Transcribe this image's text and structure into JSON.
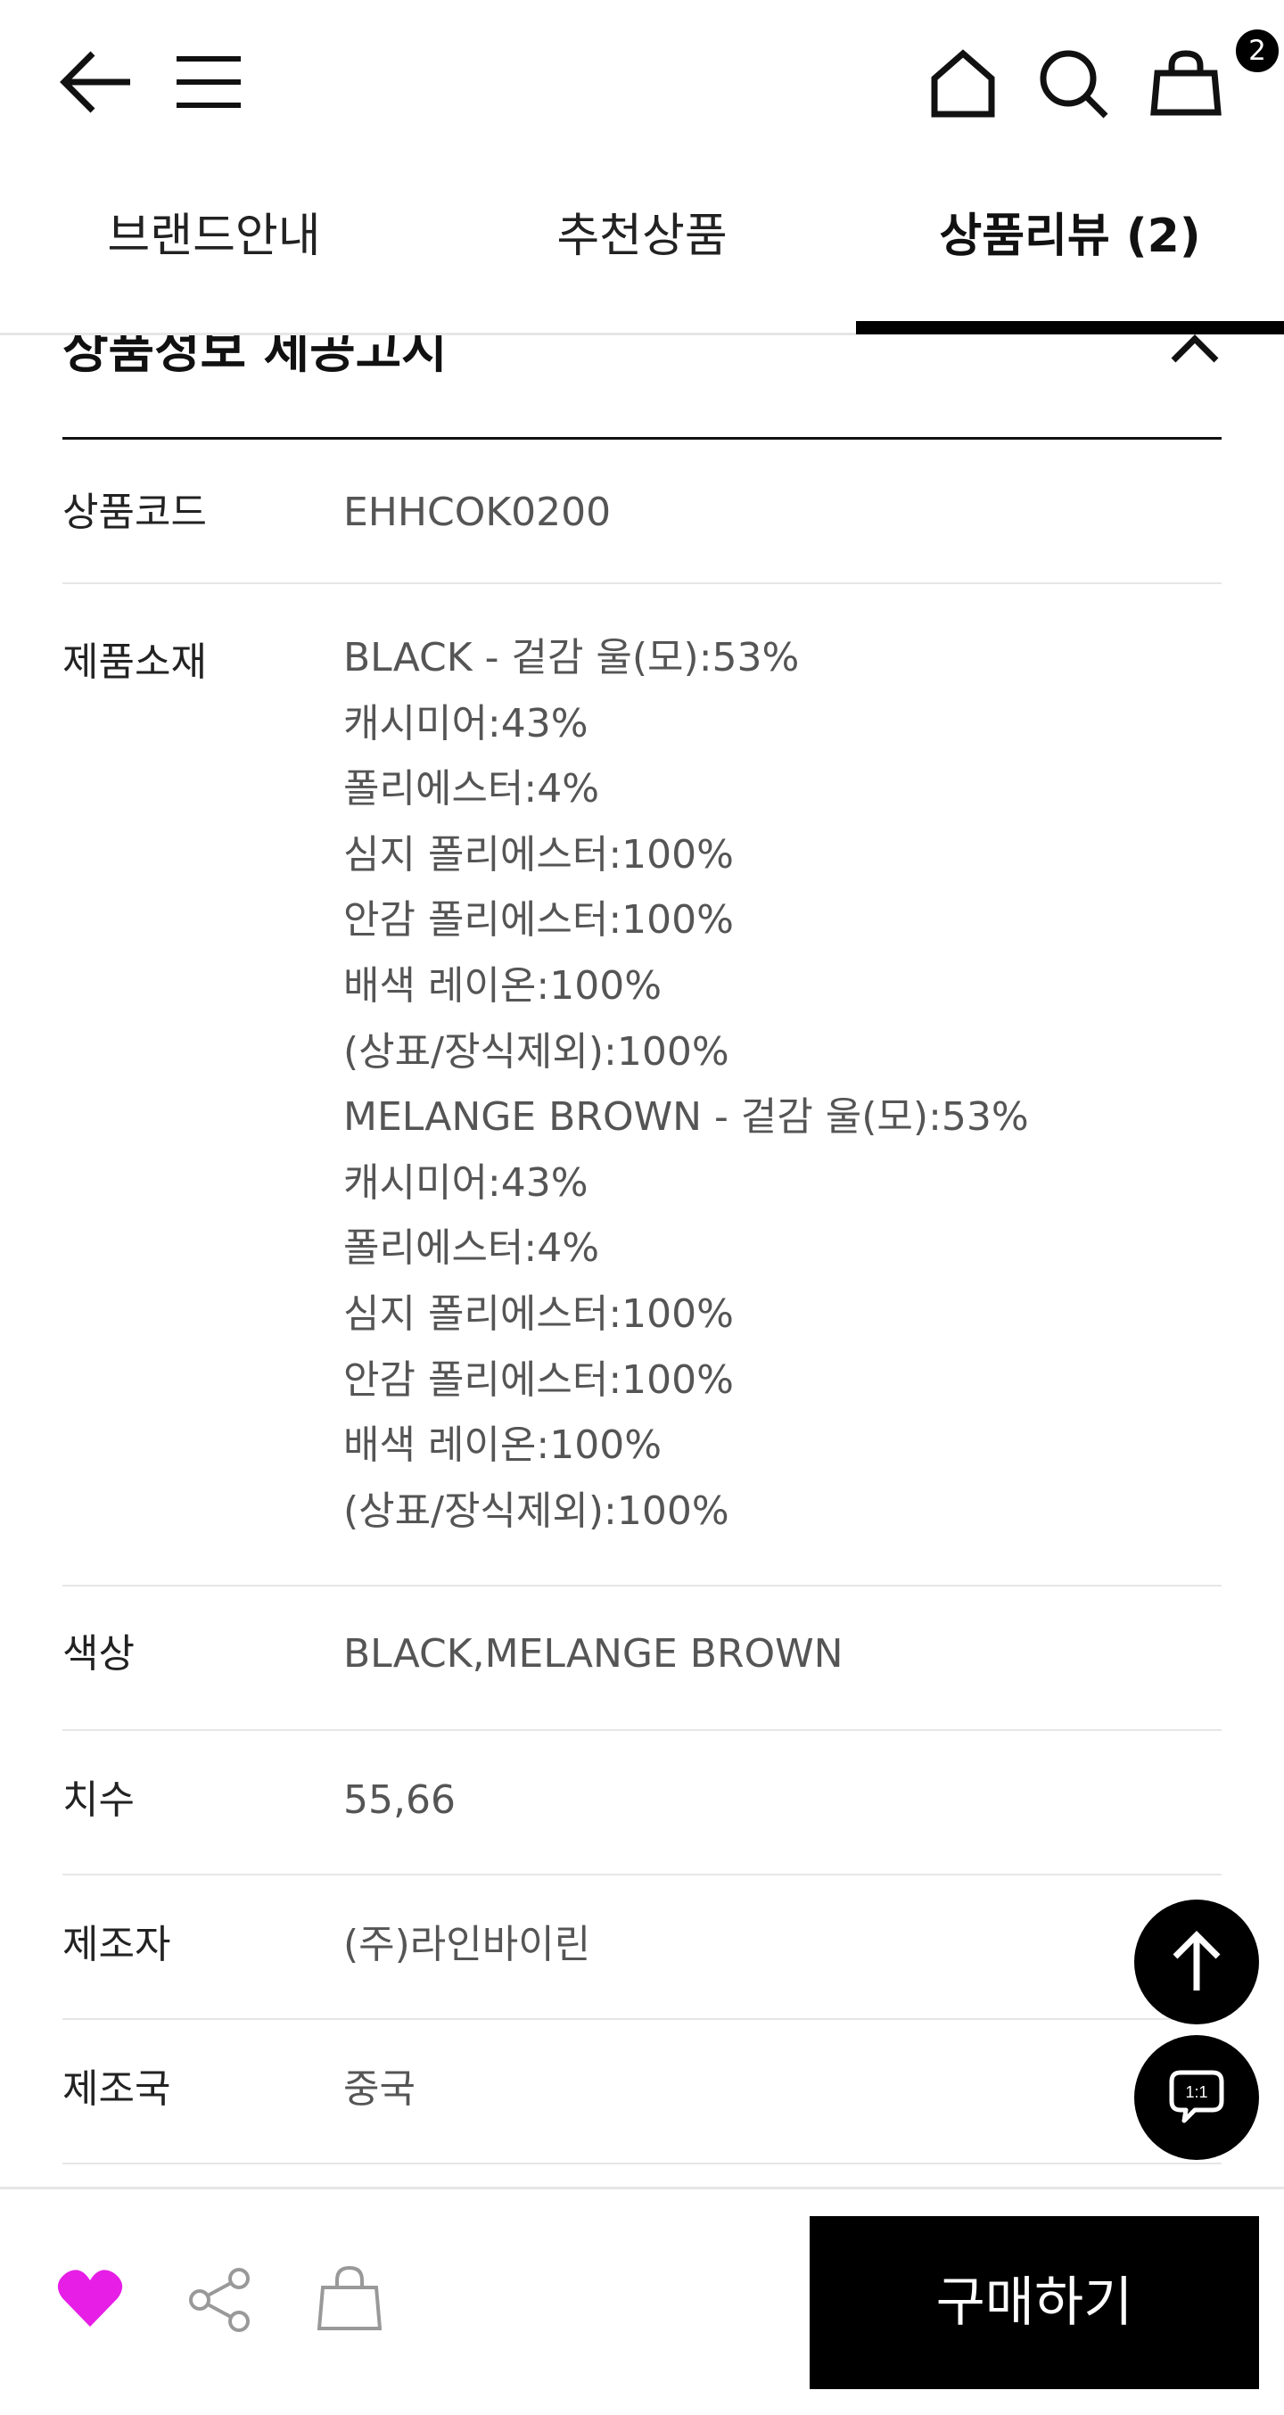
{
  "header": {
    "cart_count": "2",
    "icons": [
      "back-arrow-icon",
      "menu-icon",
      "home-icon",
      "search-icon",
      "cart-icon"
    ]
  },
  "tabs": [
    {
      "label": "브랜드안내"
    },
    {
      "label": "추천상품"
    },
    {
      "label": "상품리뷰 (2)",
      "active": true
    }
  ],
  "section": {
    "title": "상품정보 제공고시"
  },
  "info_rows": [
    {
      "label": "상품코드",
      "lines": [
        "EHHCOK0200"
      ]
    },
    {
      "label": "제품소재",
      "lines": [
        "BLACK - 겉감 울(모):53%",
        "캐시미어:43%",
        "폴리에스터:4%",
        "심지 폴리에스터:100%",
        "안감 폴리에스터:100%",
        "배색 레이온:100%",
        "(상표/장식제외):100%",
        "MELANGE BROWN - 겉감 울(모):53%",
        "캐시미어:43%",
        "폴리에스터:4%",
        "심지 폴리에스터:100%",
        "안감 폴리에스터:100%",
        "배색 레이온:100%",
        "(상표/장식제외):100%"
      ]
    },
    {
      "label": "색상",
      "lines": [
        "BLACK,MELANGE BROWN"
      ]
    },
    {
      "label": "치수",
      "lines": [
        "55,66"
      ]
    },
    {
      "label": "제조자",
      "lines": [
        "(주)라인바이린"
      ]
    },
    {
      "label": "제조국",
      "lines": [
        "중국"
      ]
    }
  ],
  "floating": {
    "chat_label": "1:1"
  },
  "bottom_bar": {
    "buy_label": "구매하기",
    "heart_color": "#e61ee6"
  }
}
